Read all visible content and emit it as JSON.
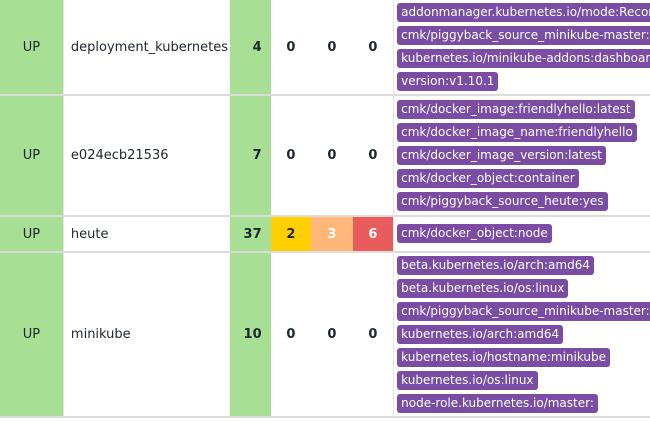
{
  "hosts": [
    {
      "state": "UP",
      "name": "deployment_kubernetes",
      "ok": "4",
      "warn": "0",
      "unknown": "0",
      "crit": "0",
      "labels": [
        "addonmanager.kubernetes.io/mode:Reconcile",
        "cmk/piggyback_source_minikube-master:yes",
        "kubernetes.io/minikube-addons:dashboard",
        "version:v1.10.1"
      ]
    },
    {
      "state": "UP",
      "name": "e024ecb21536",
      "ok": "7",
      "warn": "0",
      "unknown": "0",
      "crit": "0",
      "labels": [
        "cmk/docker_image:friendlyhello:latest",
        "cmk/docker_image_name:friendlyhello",
        "cmk/docker_image_version:latest",
        "cmk/docker_object:container",
        "cmk/piggyback_source_heute:yes"
      ]
    },
    {
      "state": "UP",
      "name": "heute",
      "ok": "37",
      "warn": "2",
      "unknown": "3",
      "crit": "6",
      "labels": [
        "cmk/docker_object:node"
      ]
    },
    {
      "state": "UP",
      "name": "minikube",
      "ok": "10",
      "warn": "0",
      "unknown": "0",
      "crit": "0",
      "labels": [
        "beta.kubernetes.io/arch:amd64",
        "beta.kubernetes.io/os:linux",
        "cmk/piggyback_source_minikube-master:yes",
        "kubernetes.io/arch:amd64",
        "kubernetes.io/hostname:minikube",
        "kubernetes.io/os:linux",
        "node-role.kubernetes.io/master:"
      ]
    }
  ],
  "colors": {
    "state_up": "#a7df94",
    "warn": "#ffcf00",
    "unknown": "#ffb87a",
    "crit": "#e95c5c",
    "label_bg": "#7b4ca3"
  }
}
